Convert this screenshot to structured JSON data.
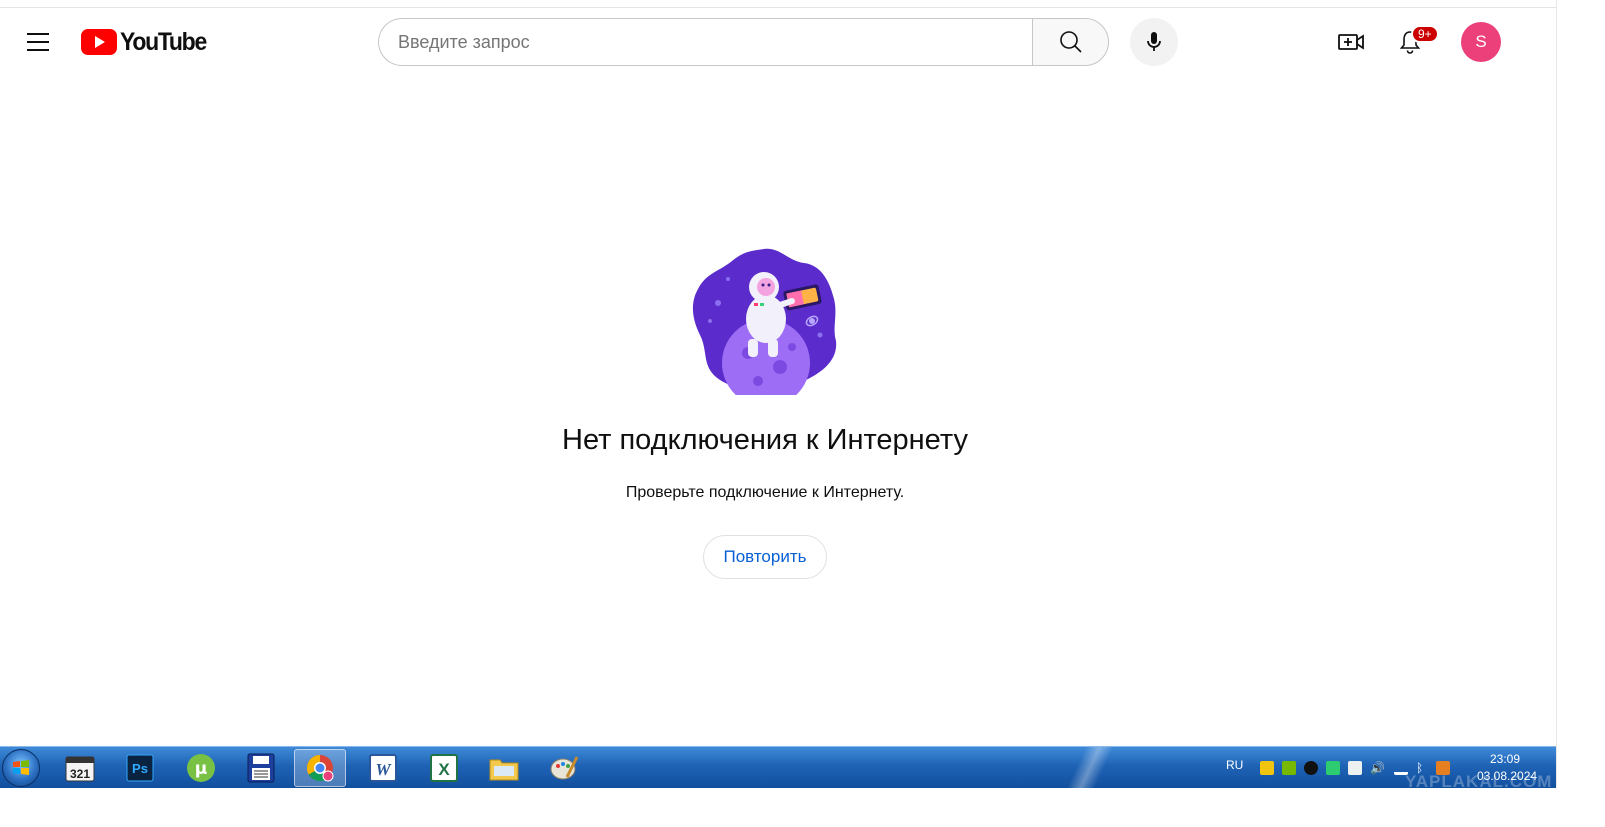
{
  "header": {
    "logo_text": "YouTube",
    "search_placeholder": "Введите запрос",
    "notification_badge": "9+",
    "avatar_letter": "S"
  },
  "main": {
    "title": "Нет подключения к Интернету",
    "subtitle": "Проверьте подключение к Интернету.",
    "retry_label": "Повторить"
  },
  "taskbar": {
    "apps": [
      {
        "name": "media-player-classic-icon",
        "label": "321"
      },
      {
        "name": "photoshop-icon",
        "label": "Ps"
      },
      {
        "name": "utorrent-icon",
        "label": "µ"
      },
      {
        "name": "save-floppy-icon",
        "label": ""
      },
      {
        "name": "chrome-icon",
        "label": ""
      },
      {
        "name": "word-icon",
        "label": "W"
      },
      {
        "name": "excel-icon",
        "label": "X"
      },
      {
        "name": "file-explorer-icon",
        "label": ""
      },
      {
        "name": "paint-icon",
        "label": ""
      }
    ],
    "language": "RU",
    "time": "23:09",
    "date": "03.08.2024"
  },
  "watermark": "YAPLAKAL.COM",
  "colors": {
    "brand_red": "#ff0000",
    "avatar_bg": "#ec407a",
    "link_blue": "#065fd4",
    "badge_red": "#cc0000"
  }
}
